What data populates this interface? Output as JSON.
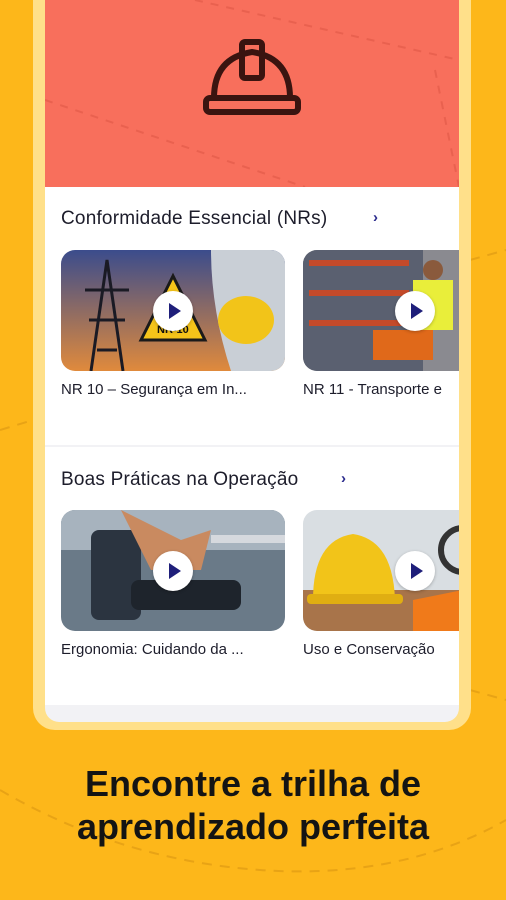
{
  "sections": [
    {
      "title": "Conformidade Essencial (NRs)",
      "cards": [
        {
          "title": "NR 10 – Segurança em In...",
          "sign_text": "NR-10"
        },
        {
          "title": "NR 11 - Transporte e"
        }
      ]
    },
    {
      "title": "Boas Práticas na Operação",
      "cards": [
        {
          "title": "Ergonomia: Cuidando da ..."
        },
        {
          "title": "Uso e Conservação"
        }
      ]
    }
  ],
  "caption": {
    "line1": "Encontre a trilha de",
    "line2": "aprendizado perfeita"
  },
  "colors": {
    "background": "#FDB71A",
    "hero": "#F86F5C",
    "accent": "#2A2A8C"
  },
  "icons": {
    "hero": "hard-hat-icon",
    "section_arrow": "chevron-right-icon",
    "card_play": "play-icon"
  }
}
